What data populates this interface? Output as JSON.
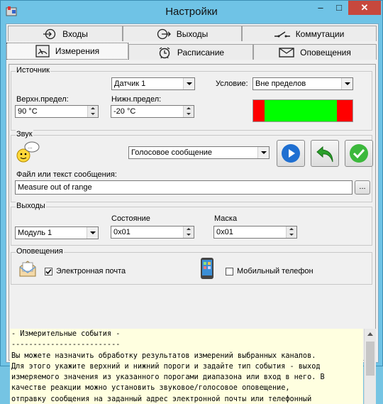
{
  "window": {
    "title": "Настройки",
    "close_glyph": "✕",
    "min_glyph": "–",
    "max_glyph": "□"
  },
  "tabs_row1": [
    {
      "label": "Входы",
      "icon": "input-arrow-icon"
    },
    {
      "label": "Выходы",
      "icon": "output-arrow-icon"
    },
    {
      "label": "Коммутации",
      "icon": "switch-icon"
    }
  ],
  "tabs_row2": [
    {
      "label": "Измерения",
      "icon": "gauge-icon",
      "active": true
    },
    {
      "label": "Расписание",
      "icon": "alarm-clock-icon"
    },
    {
      "label": "Оповещения",
      "icon": "envelope-icon"
    }
  ],
  "source": {
    "group_title": "Источник",
    "sensor_value": "Датчик 1",
    "upper_label": "Верхн.предел:",
    "upper_value": "90 °C",
    "lower_label": "Нижн.предел:",
    "lower_value": "-20 °C",
    "condition_label": "Условие:",
    "condition_value": "Вне пределов",
    "range_colors": {
      "out": "#ff0000",
      "in": "#00ff00"
    }
  },
  "sound": {
    "group_title": "Звук",
    "type_value": "Голосовое сообщение",
    "file_label": "Файл или текст сообщения:",
    "file_value": "Measure out of range",
    "browse_label": "..."
  },
  "outputs": {
    "group_title": "Выходы",
    "module_value": "Модуль 1",
    "state_label": "Состояние",
    "state_value": "0x01",
    "mask_label": "Маска",
    "mask_value": "0x01"
  },
  "notifications": {
    "group_title": "Оповещения",
    "email_label": "Электронная почта",
    "email_checked": true,
    "phone_label": "Мобильный телефон",
    "phone_checked": false
  },
  "help": {
    "lines": [
      "- Измерительные события -",
      "-------------------------",
      "Вы можете назначить обработку результатов измерений выбранных каналов.",
      "Для этого укажите верхний и нижний пороги и задайте тип события - выход",
      "измеряемого значения из указанного порогами диапазона или вход в него. В",
      "качестве реакции можно установить звуковое/голосовое оповещение,",
      "отправку сообщения на заданный адрес электронной почты или телефонный"
    ]
  }
}
